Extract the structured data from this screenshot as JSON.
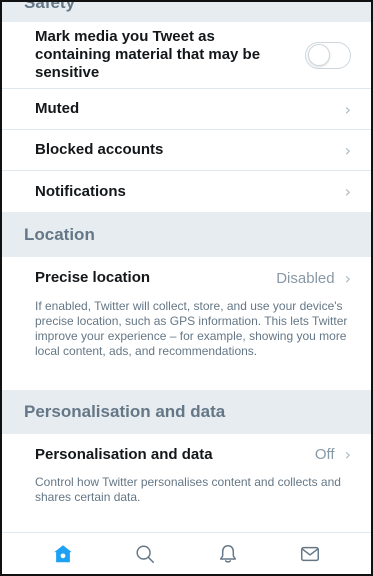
{
  "sections": {
    "safety_title": "Safety",
    "location_title": "Location",
    "personalisation_title": "Personalisation and data"
  },
  "safety": {
    "sensitive_label": "Mark media you Tweet as containing material that may be sensitive",
    "muted_label": "Muted",
    "blocked_label": "Blocked accounts",
    "notifications_label": "Notifications"
  },
  "location": {
    "precise_label": "Precise location",
    "precise_value": "Disabled",
    "precise_desc": "If enabled, Twitter will collect, store, and use your device's precise location, such as GPS information. This lets Twitter improve your experience – for example, showing you more local content, ads, and recommendations."
  },
  "personalisation": {
    "label": "Personalisation and data",
    "value": "Off",
    "desc": "Control how Twitter personalises content and collects and shares certain data."
  },
  "toggle": {
    "sensitive_media_on": false
  },
  "colors": {
    "accent": "#1da1f2",
    "section_bg": "#e6ecf0",
    "muted_text": "#657786"
  },
  "icons": [
    "home-icon",
    "search-icon",
    "notifications-bell-icon",
    "messages-envelope-icon"
  ]
}
